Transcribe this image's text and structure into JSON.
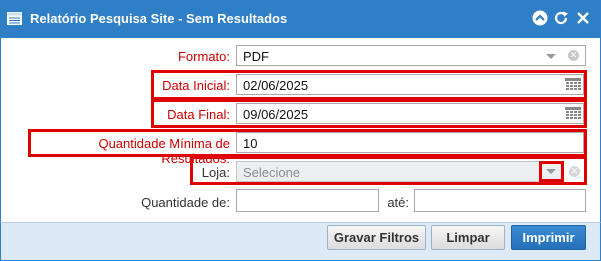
{
  "window": {
    "title": "Relatório Pesquisa Site - Sem Resultados",
    "accent_color": "#2f7fc7",
    "highlight_color": "#e00000"
  },
  "titlebar_icons": [
    "collapse-icon",
    "refresh-icon",
    "close-icon"
  ],
  "form": {
    "formato": {
      "label": "Formato:",
      "value": "PDF"
    },
    "data_inicial": {
      "label": "Data Inicial:",
      "value": "02/06/2025"
    },
    "data_final": {
      "label": "Data Final:",
      "value": "09/06/2025"
    },
    "qtd_min": {
      "label": "Quantidade Mínima de Resultados:",
      "value": "10"
    },
    "loja": {
      "label": "Loja:",
      "placeholder": "Selecione"
    },
    "qtd_de": {
      "label": "Quantidade de:",
      "value": ""
    },
    "ate": {
      "label": "até:",
      "value": ""
    }
  },
  "buttons": {
    "gravar": "Gravar Filtros",
    "limpar": "Limpar",
    "imprimir": "Imprimir"
  }
}
